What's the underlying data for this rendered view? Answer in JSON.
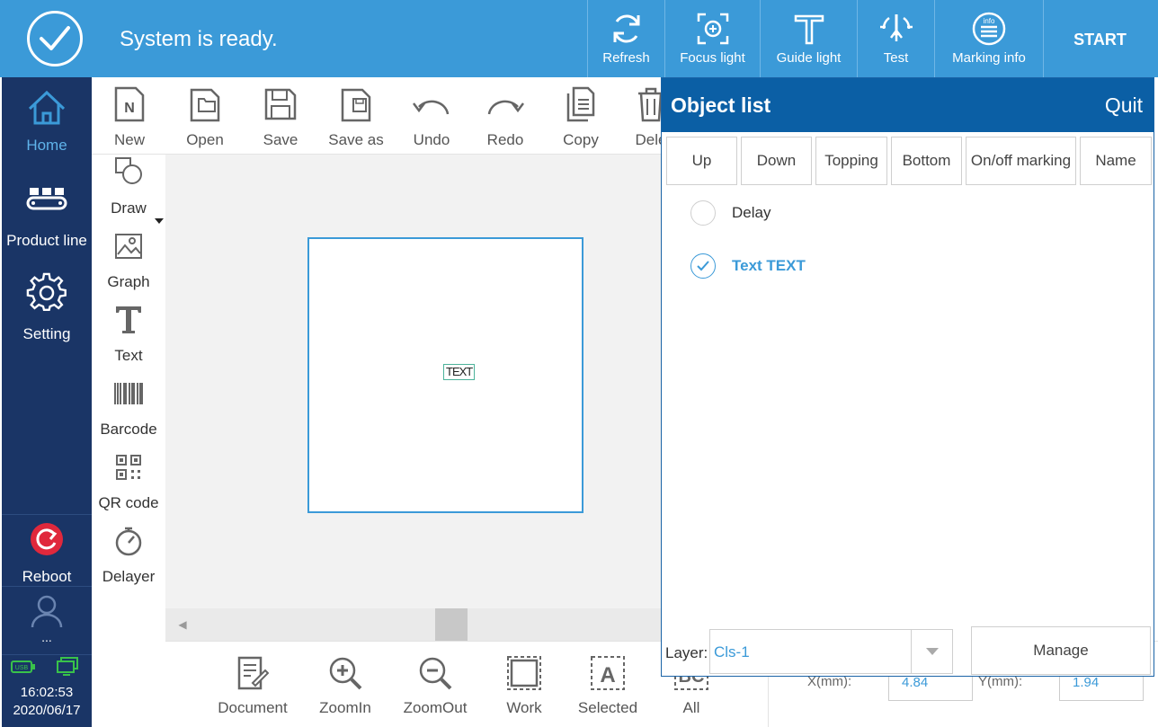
{
  "status": {
    "text": "System is ready."
  },
  "topbar": {
    "refresh": "Refresh",
    "focus_light": "Focus light",
    "guide_light": "Guide light",
    "test": "Test",
    "marking_info": "Marking info",
    "start": "START"
  },
  "sidebar": {
    "home": "Home",
    "product_line": "Product line",
    "setting": "Setting",
    "reboot": "Reboot",
    "user": "...",
    "time": "16:02:53",
    "date": "2020/06/17"
  },
  "toolbar": {
    "new": "New",
    "open": "Open",
    "save": "Save",
    "save_as": "Save as",
    "undo": "Undo",
    "redo": "Redo",
    "copy": "Copy",
    "delete": "Dele"
  },
  "tools": {
    "draw": "Draw",
    "graph": "Graph",
    "text": "Text",
    "barcode": "Barcode",
    "qr_code": "QR code",
    "delayer": "Delayer"
  },
  "canvas": {
    "object_text": "TEXT"
  },
  "bottombar": {
    "document": "Document",
    "zoomin": "ZoomIn",
    "zoomout": "ZoomOut",
    "work": "Work",
    "selected": "Selected",
    "all": "All",
    "x_label": "X(mm):",
    "x_value": "4.84",
    "y_label": "Y(mm):",
    "y_value": "1.94"
  },
  "object_list": {
    "title": "Object list",
    "quit": "Quit",
    "buttons": {
      "up": "Up",
      "down": "Down",
      "topping": "Topping",
      "bottom": "Bottom",
      "onoff": "On/off marking",
      "name": "Name"
    },
    "items": [
      {
        "label": "Delay",
        "checked": false
      },
      {
        "label": "Text TEXT",
        "checked": true
      }
    ],
    "layer_label": "Layer:",
    "layer_value": "Cls-1",
    "manage": "Manage"
  },
  "colors": {
    "topbar": "#3b9ad8",
    "sidebar": "#1a3566",
    "panel_header": "#0b5fa5",
    "accent": "#3b9ad8",
    "reboot": "#e0283c"
  }
}
